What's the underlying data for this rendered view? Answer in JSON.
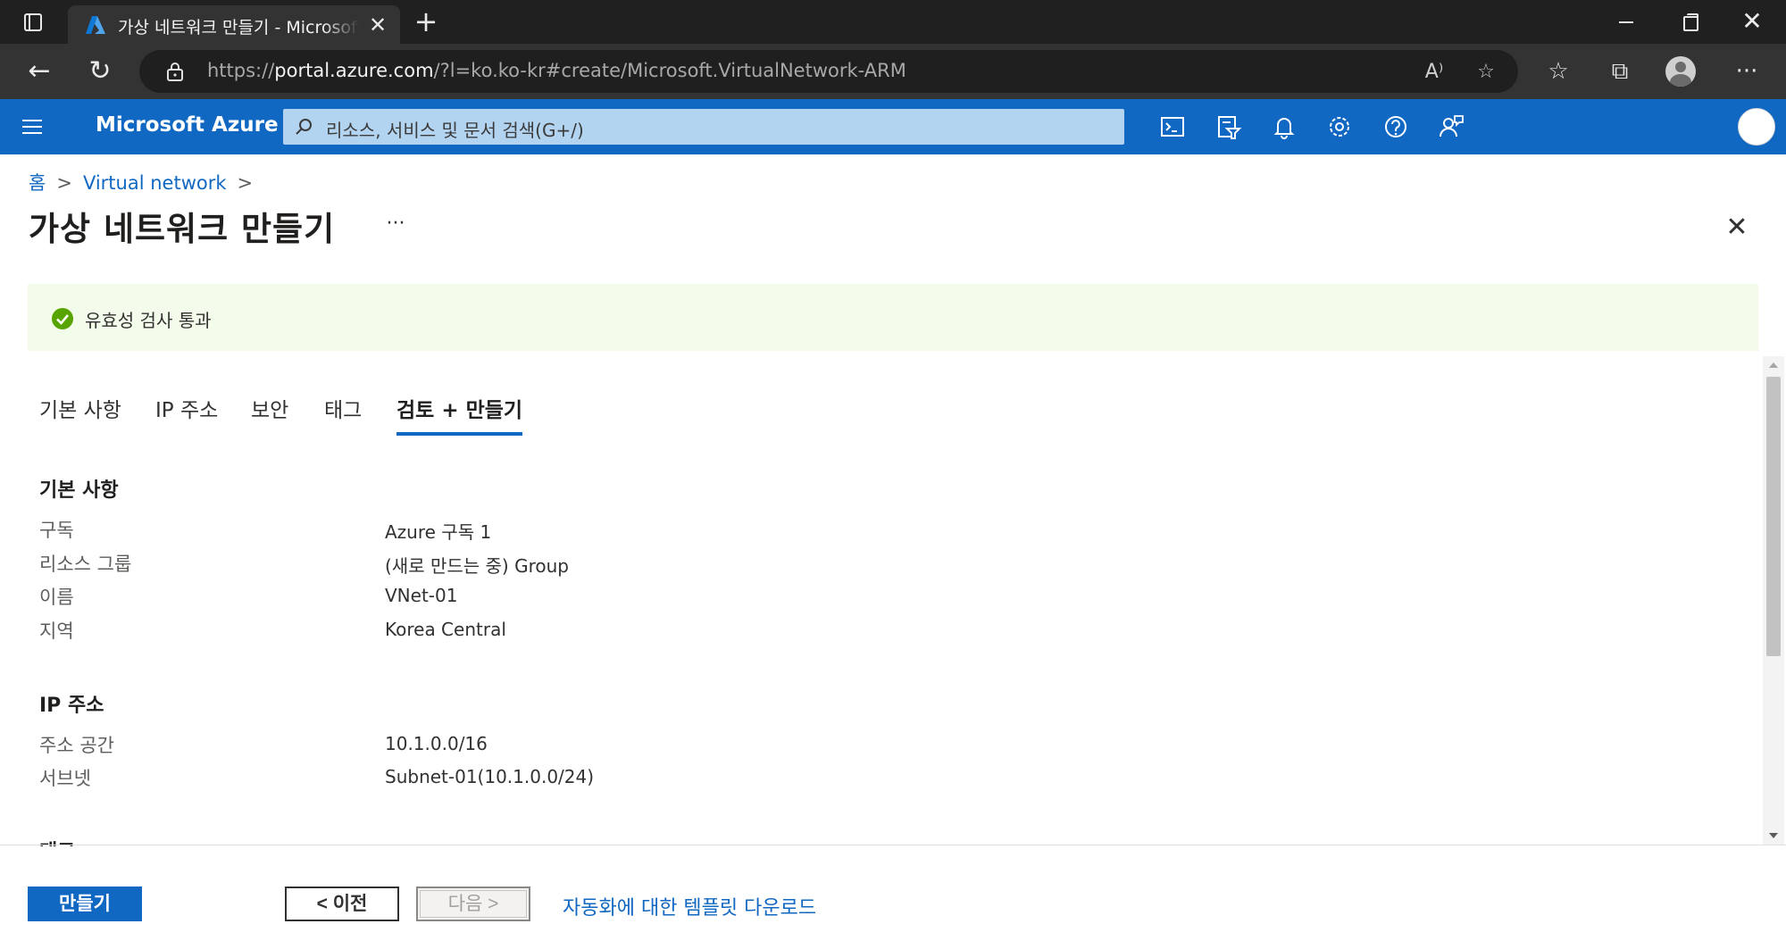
{
  "browser": {
    "tab_title": "가상 네트워크 만들기 - Microsoft Azure",
    "tab_close": "✕",
    "new_tab": "+",
    "url_prefix": "https://",
    "url_host": "portal.azure.com",
    "url_rest": "/?l=ko.ko-kr#create/Microsoft.VirtualNetwork-ARM",
    "back": "←",
    "refresh": "↻",
    "win_close": "✕",
    "read_aloud": "A⁾",
    "fav_add": "☆",
    "favorites": "☆",
    "collections": "⧉",
    "more": "···"
  },
  "azure_header": {
    "brand": "Microsoft Azure",
    "search_placeholder": "리소스, 서비스 및 문서 검색(G+/)"
  },
  "breadcrumb": [
    {
      "label": "홈"
    },
    {
      "label": "Virtual network"
    }
  ],
  "breadcrumb_sep": ">",
  "page": {
    "title": "가상 네트워크 만들기",
    "more": "···",
    "close": "✕"
  },
  "validation": {
    "message": "유효성 검사 통과",
    "status_color": "#57a300"
  },
  "tabs": [
    {
      "label": "기본 사항",
      "active": false
    },
    {
      "label": "IP 주소",
      "active": false
    },
    {
      "label": "보안",
      "active": false
    },
    {
      "label": "태그",
      "active": false
    },
    {
      "label": "검토 + 만들기",
      "active": true
    }
  ],
  "sections": {
    "basics": {
      "heading": "기본 사항",
      "rows": [
        {
          "label": "구독",
          "value": "Azure 구독 1"
        },
        {
          "label": "리소스 그룹",
          "value": "(새로 만드는 중) Group"
        },
        {
          "label": "이름",
          "value": "VNet-01"
        },
        {
          "label": "지역",
          "value": "Korea Central"
        }
      ]
    },
    "ip": {
      "heading": "IP 주소",
      "rows": [
        {
          "label": "주소 공간",
          "value": "10.1.0.0/16"
        },
        {
          "label": "서브넷",
          "value": "Subnet-01(10.1.0.0/24)"
        }
      ]
    },
    "tags_heading_partial": "태그"
  },
  "footer": {
    "create": "만들기",
    "previous": "< 이전",
    "next": "다음 >",
    "template_link": "자동화에 대한 템플릿 다운로드"
  },
  "colors": {
    "azure_blue": "#1168c2",
    "validation_bg": "#f3fbea"
  }
}
